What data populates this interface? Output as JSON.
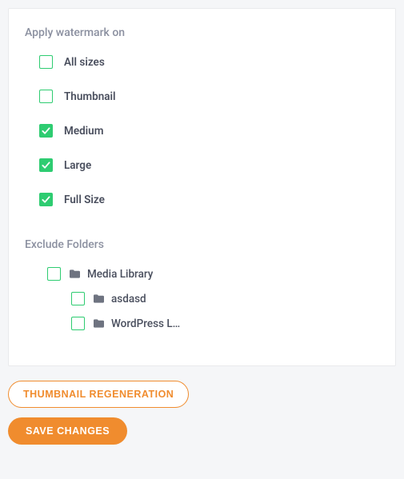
{
  "colors": {
    "checkbox_green": "#2ecc71",
    "accent_orange": "#f08c2e",
    "text_muted": "#8b90a0",
    "text_body": "#4a4f5e"
  },
  "sections": {
    "watermark_title": "Apply watermark on",
    "exclude_title": "Exclude Folders"
  },
  "sizes": [
    {
      "label": "All sizes",
      "checked": false
    },
    {
      "label": "Thumbnail",
      "checked": false
    },
    {
      "label": "Medium",
      "checked": true
    },
    {
      "label": "Large",
      "checked": true
    },
    {
      "label": "Full Size",
      "checked": true
    }
  ],
  "folders": {
    "root": {
      "label": "Media Library",
      "checked": false
    },
    "children": [
      {
        "label": "asdasd",
        "checked": false
      },
      {
        "label": "WordPress L…",
        "checked": false
      }
    ]
  },
  "buttons": {
    "regenerate": "THUMBNAIL REGENERATION",
    "save": "SAVE CHANGES"
  }
}
